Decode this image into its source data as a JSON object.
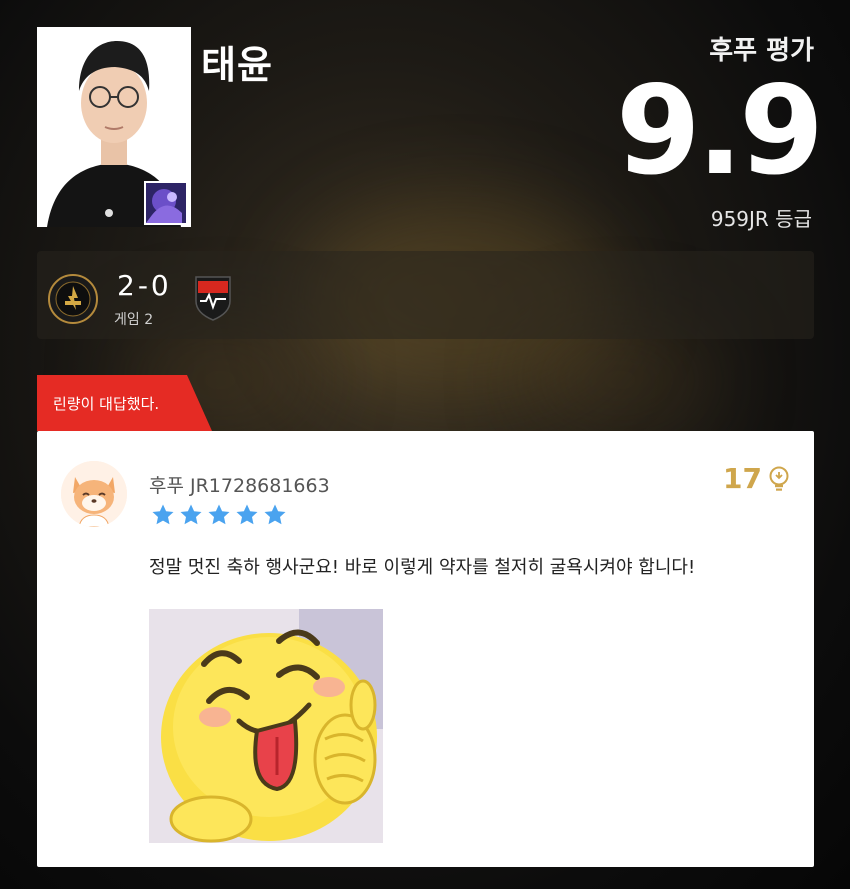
{
  "player": {
    "name": "태윤",
    "photo_icon": "player-portrait",
    "champion_icon": "champion-portrait"
  },
  "rating": {
    "label": "후푸 평가",
    "value": "9.9",
    "grade": "959JR 등급"
  },
  "match": {
    "score": "2-0",
    "game": "게임 2",
    "left_team_icon": "team-logo-fearx",
    "right_team_icon": "team-logo-hanwha"
  },
  "reply_tag": "린량이 대답했다.",
  "comment": {
    "username": "후푸 JR1728681663",
    "stars": 5,
    "likes": "17",
    "text": "정말 멋진 축하 행사군요! 바로 이렇게 약자를 철저히 굴욕시켜야 합니다!",
    "avatar_icon": "fox-avatar",
    "sticker_icon": "tongue-emoji-thumbs-up"
  },
  "colors": {
    "accent_red": "#e52b24",
    "star_blue": "#4aa3ef",
    "likes_gold": "#cfa64c"
  }
}
